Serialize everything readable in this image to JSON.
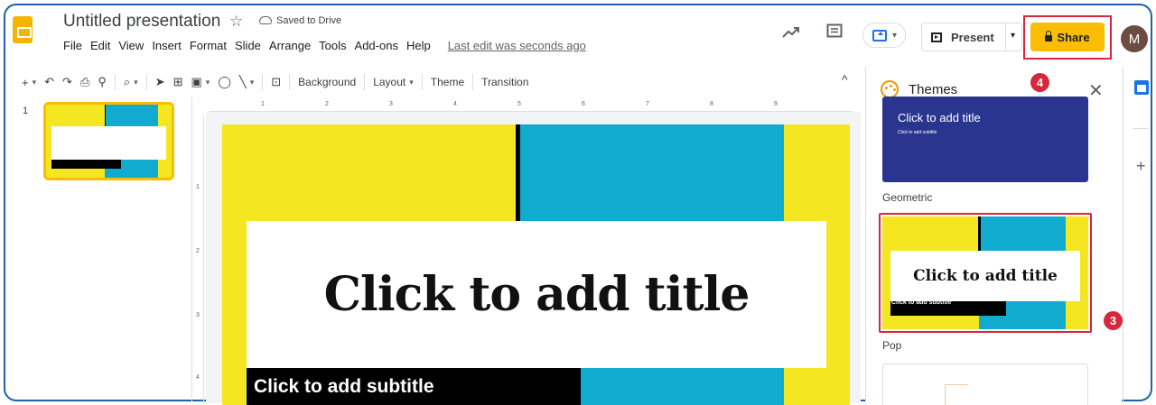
{
  "header": {
    "title": "Untitled presentation",
    "save_status": "Saved to Drive",
    "last_edit": "Last edit was seconds ago",
    "menu": [
      "File",
      "Edit",
      "View",
      "Insert",
      "Format",
      "Slide",
      "Arrange",
      "Tools",
      "Add-ons",
      "Help"
    ],
    "present_label": "Present",
    "share_label": "Share",
    "avatar_letter": "M"
  },
  "toolbar": {
    "background_label": "Background",
    "layout_label": "Layout",
    "theme_label": "Theme",
    "transition_label": "Transition"
  },
  "filmstrip": {
    "slide_number": "1"
  },
  "ruler": {
    "h_ticks": [
      "1",
      "2",
      "3",
      "4",
      "5",
      "6",
      "7",
      "8",
      "9"
    ],
    "v_ticks": [
      "1",
      "2",
      "3",
      "4"
    ]
  },
  "slide": {
    "title_placeholder": "Click to add title",
    "subtitle_placeholder": "Click to add subtitle"
  },
  "themes_panel": {
    "title": "Themes",
    "themes": [
      {
        "name": "Geometric",
        "preview_title": "Click to add title",
        "preview_subtitle": "Click to add subtitle"
      },
      {
        "name": "Pop",
        "preview_title": "Click to add title",
        "preview_subtitle": "Click to add subtitle"
      }
    ]
  },
  "annotations": {
    "share_step": "4",
    "theme_step": "3"
  },
  "colors": {
    "accent_yellow": "#f4e620",
    "accent_cyan": "#11abd0",
    "share_button": "#fbbc04",
    "annotation_red": "#d7263d",
    "frame_border": "#1d62a8",
    "geometric_theme_bg": "#2a3590"
  }
}
